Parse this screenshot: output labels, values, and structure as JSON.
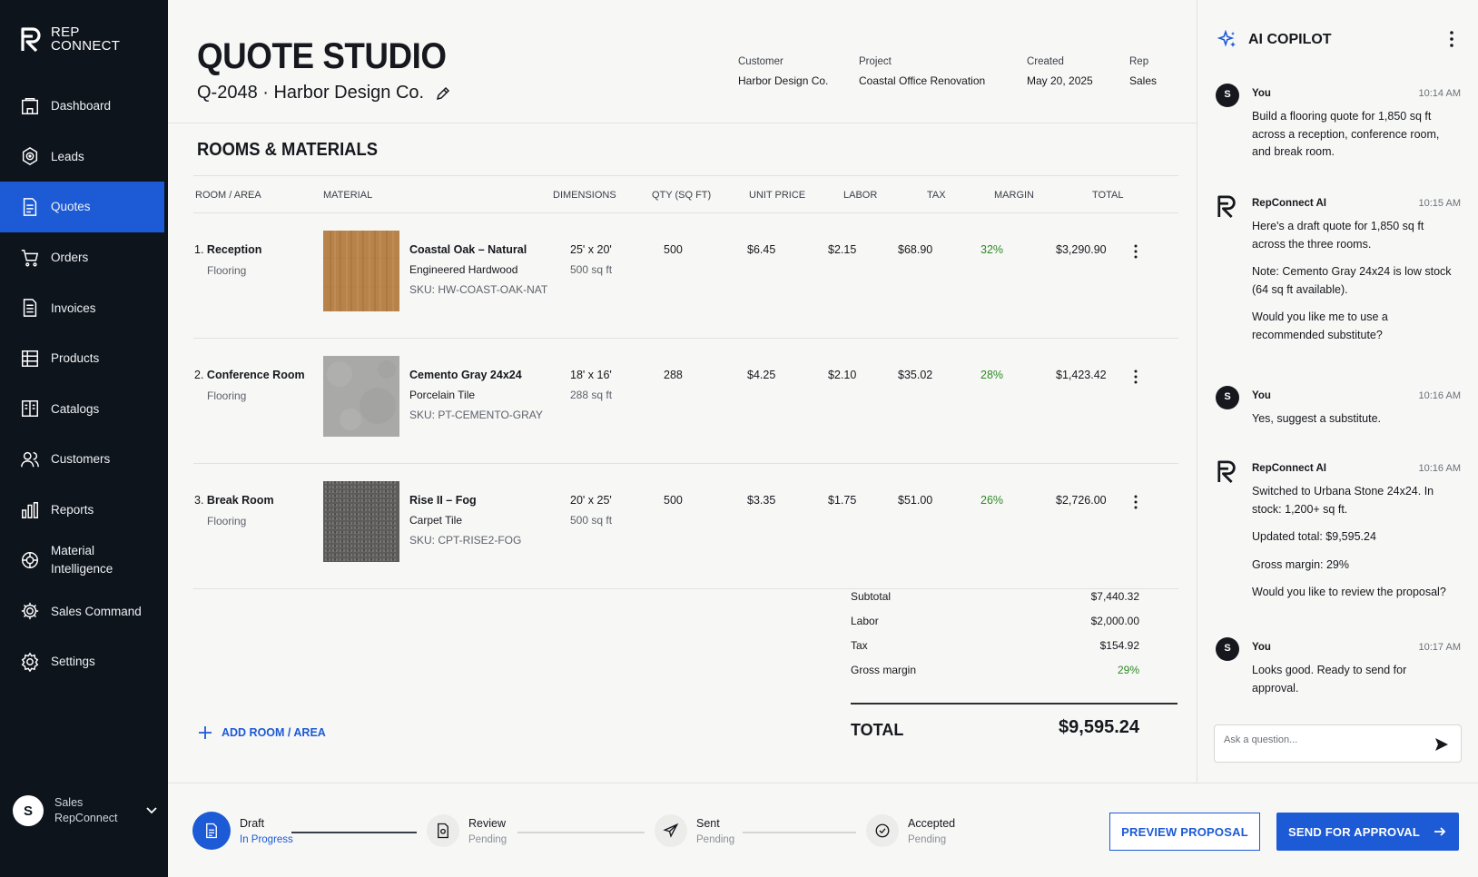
{
  "brand": {
    "line1": "REP",
    "line2": "CONNECT"
  },
  "nav": [
    {
      "label": "Dashboard",
      "icon": "home-icon",
      "active": false
    },
    {
      "label": "Leads",
      "icon": "target-icon",
      "active": false
    },
    {
      "label": "Quotes",
      "icon": "document-icon",
      "active": true
    },
    {
      "label": "Orders",
      "icon": "cart-icon",
      "active": false
    },
    {
      "label": "Invoices",
      "icon": "invoice-icon",
      "active": false
    },
    {
      "label": "Products",
      "icon": "products-icon",
      "active": false
    },
    {
      "label": "Catalogs",
      "icon": "book-icon",
      "active": false
    },
    {
      "label": "Customers",
      "icon": "users-icon",
      "active": false
    },
    {
      "label": "Reports",
      "icon": "bar-chart-icon",
      "active": false
    },
    {
      "label": "Material Intelligence",
      "label1": "Material",
      "label2": "Intelligence",
      "icon": "brain-icon",
      "active": false
    },
    {
      "label": "Sales Command",
      "icon": "command-gear-icon",
      "active": false
    },
    {
      "label": "Settings",
      "icon": "gear-icon",
      "active": false
    }
  ],
  "user": {
    "initial": "S",
    "line1": "Sales",
    "line2": "RepConnect"
  },
  "page": {
    "title": "QUOTE STUDIO",
    "quote_line": "Q-2048 · Harbor Design Co.",
    "meta": [
      {
        "label": "Customer",
        "value": "Harbor Design Co."
      },
      {
        "label": "Project",
        "value": "Coastal Office Renovation"
      },
      {
        "label": "Created",
        "value": "May 20, 2025"
      },
      {
        "label": "Rep",
        "value": "Sales"
      }
    ],
    "section_title": "ROOMS & MATERIALS"
  },
  "table": {
    "headers": {
      "room": "ROOM / AREA",
      "material": "MATERIAL",
      "dimensions": "DIMENSIONS",
      "qty": "QTY (SQ FT)",
      "unit_price": "UNIT PRICE",
      "labor": "LABOR",
      "tax": "TAX",
      "margin": "MARGIN",
      "total": "TOTAL"
    },
    "rows": [
      {
        "num": "1.",
        "room": "Reception",
        "room_type": "Flooring",
        "material": "Coastal Oak – Natural",
        "material_type": "Engineered Hardwood",
        "sku": "SKU: HW-COAST-OAK-NAT",
        "dims": "25' x 20'",
        "dims_sub": "500 sq ft",
        "qty": "500",
        "unit_price": "$6.45",
        "labor": "$2.15",
        "tax": "$68.90",
        "margin": "32%",
        "total": "$3,290.90",
        "swatch": "wood"
      },
      {
        "num": "2.",
        "room": "Conference Room",
        "room_type": "Flooring",
        "material": "Cemento Gray 24x24",
        "material_type": "Porcelain Tile",
        "sku": "SKU: PT-CEMENTO-GRAY",
        "dims": "18' x 16'",
        "dims_sub": "288 sq ft",
        "qty": "288",
        "unit_price": "$4.25",
        "labor": "$2.10",
        "tax": "$35.02",
        "margin": "28%",
        "total": "$1,423.42",
        "swatch": "concrete"
      },
      {
        "num": "3.",
        "room": "Break Room",
        "room_type": "Flooring",
        "material": "Rise II – Fog",
        "material_type": "Carpet Tile",
        "sku": "SKU: CPT-RISE2-FOG",
        "dims": "20' x 25'",
        "dims_sub": "500 sq ft",
        "qty": "500",
        "unit_price": "$3.35",
        "labor": "$1.75",
        "tax": "$51.00",
        "margin": "26%",
        "total": "$2,726.00",
        "swatch": "carpet"
      }
    ]
  },
  "totals": {
    "subtotal_label": "Subtotal",
    "subtotal": "$7,440.32",
    "labor_label": "Labor",
    "labor": "$2,000.00",
    "tax_label": "Tax",
    "tax": "$154.92",
    "margin_label": "Gross margin",
    "margin": "29%",
    "total_label": "TOTAL",
    "total": "$9,595.24"
  },
  "add_room_label": "ADD ROOM / AREA",
  "steps": [
    {
      "label": "Draft",
      "status": "In Progress",
      "icon": "document-icon"
    },
    {
      "label": "Review",
      "status": "Pending",
      "icon": "review-icon"
    },
    {
      "label": "Sent",
      "status": "Pending",
      "icon": "send-icon"
    },
    {
      "label": "Accepted",
      "status": "Pending",
      "icon": "check-circle-icon"
    }
  ],
  "buttons": {
    "preview": "PREVIEW PROPOSAL",
    "send": "SEND FOR APPROVAL"
  },
  "copilot": {
    "title": "AI COPILOT",
    "input_placeholder": "Ask a question...",
    "messages": [
      {
        "who": "You",
        "time": "10:14 AM",
        "paras": [
          "Build a flooring quote for 1,850 sq ft across a reception, conference room, and break room."
        ]
      },
      {
        "who": "RepConnect AI",
        "time": "10:15 AM",
        "paras": [
          "Here's a draft quote for 1,850 sq ft across the three rooms.",
          "Note: Cemento Gray 24x24 is low stock (64 sq ft available).",
          "Would you like me to use a recommended substitute?"
        ]
      },
      {
        "who": "You",
        "time": "10:16 AM",
        "paras": [
          "Yes, suggest a substitute."
        ]
      },
      {
        "who": "RepConnect AI",
        "time": "10:16 AM",
        "paras": [
          "Switched to Urbana Stone 24x24. In stock: 1,200+ sq ft.",
          "Updated total: $9,595.24",
          "Gross margin: 29%",
          "Would you like to review the proposal?"
        ]
      },
      {
        "who": "You",
        "time": "10:17 AM",
        "paras": [
          "Looks good. Ready to send for approval."
        ]
      }
    ]
  },
  "colors": {
    "accent": "#1d5ad6",
    "sidebar": "#0e141c",
    "margin_green": "#2f8a26"
  }
}
